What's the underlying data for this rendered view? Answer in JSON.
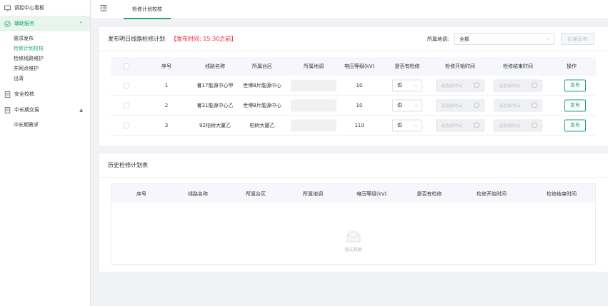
{
  "sidebar": {
    "items": [
      {
        "label": "调控中心看板",
        "icon": "monitor-icon"
      },
      {
        "label": "辅助服务",
        "icon": "check-circle-icon",
        "expanded": true
      },
      {
        "label": "安全校核",
        "icon": "document-icon"
      },
      {
        "label": "中长期交易",
        "icon": "document-icon",
        "expanded": true
      }
    ],
    "aux_sub": [
      "需求发布",
      "检修计划校核",
      "检修线路维护",
      "并网点维护",
      "出清"
    ],
    "long_sub": [
      "中长期需求"
    ],
    "active_sub": "检修计划校核"
  },
  "topbar": {
    "tab_label": "检修计划校核"
  },
  "plan": {
    "title": "发布明日线路检修计划",
    "hint": "【发布时间: 15:30之前】",
    "region_label": "所属地调:",
    "region_value": "全部",
    "batch_label": "批量发布",
    "columns": [
      "序号",
      "线路名称",
      "所属台区",
      "所属地调",
      "电压等级(kV)",
      "是否有检修",
      "检修开始时间",
      "检修结束时间",
      "操作"
    ],
    "rows": [
      {
        "index": "1",
        "line": "睿17能源中心甲",
        "area": "世博B片能源中心",
        "voltage": "10",
        "maint": "否",
        "start_ph": "请选择时间",
        "end_ph": "请选择时间",
        "action": "发布"
      },
      {
        "index": "2",
        "line": "睿31能源中心乙",
        "area": "世博B片能源中心",
        "voltage": "10",
        "maint": "否",
        "start_ph": "请选择时间",
        "end_ph": "请选择时间",
        "action": "发布"
      },
      {
        "index": "3",
        "line": "92柏树大厦乙",
        "area": "柏树大厦乙",
        "voltage": "110",
        "maint": "否",
        "start_ph": "请选择时间",
        "end_ph": "请选择时间",
        "action": "发布"
      }
    ]
  },
  "history": {
    "title": "历史检修计划表",
    "columns": [
      "序号",
      "线路名称",
      "所属台区",
      "所属地调",
      "电压等级(kV)",
      "是否有检修",
      "检修开始时间",
      "检修结束时间"
    ],
    "empty_text": "暂无数据"
  },
  "colors": {
    "accent": "#1aa86f",
    "hint": "#f5222d"
  }
}
